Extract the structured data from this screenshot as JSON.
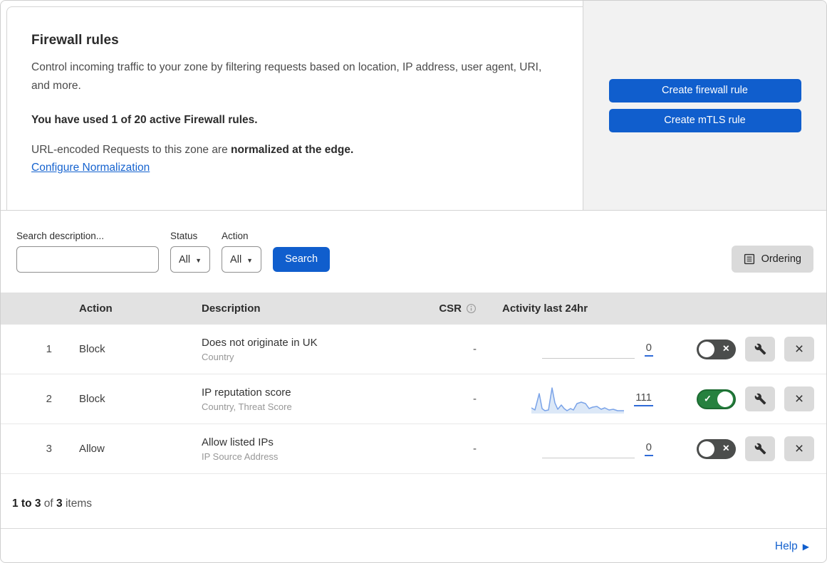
{
  "header": {
    "title": "Firewall rules",
    "description": "Control incoming traffic to your zone by filtering requests based on location, IP address, user agent, URI, and more.",
    "usage": "You have used 1 of 20 active Firewall rules.",
    "normalization_prefix": "URL-encoded Requests to this zone are ",
    "normalization_bold": "normalized at the edge.",
    "normalization_link": "Configure Normalization",
    "create_firewall_label": "Create firewall rule",
    "create_mtls_label": "Create mTLS rule"
  },
  "filters": {
    "search_label": "Search description...",
    "status_label": "Status",
    "status_value": "All",
    "action_label": "Action",
    "action_value": "All",
    "search_button_label": "Search",
    "ordering_label": "Ordering"
  },
  "table": {
    "columns": {
      "action": "Action",
      "description": "Description",
      "csr": "CSR",
      "activity": "Activity last 24hr"
    },
    "rows": [
      {
        "index": "1",
        "action": "Block",
        "description": "Does not originate in UK",
        "criteria": "Country",
        "csr": "-",
        "count": "0",
        "toggle": "off"
      },
      {
        "index": "2",
        "action": "Block",
        "description": "IP reputation score",
        "criteria": "Country, Threat Score",
        "csr": "-",
        "count": "111",
        "toggle": "on",
        "spark": {
          "line": "0,32 5,35 11,12 15,33 19,36 24,35 29,4 33,25 37,34 42,28 46,33 50,36 55,33 59,35 64,26 70,24 76,26 81,33 86,31 92,30 98,34 103,32 109,35 115,34 121,36 130,36",
          "fill": "0,32 5,35 11,12 15,33 19,36 24,35 29,4 33,25 37,34 42,28 46,33 50,36 55,33 59,35 64,26 70,24 76,26 81,33 86,31 92,30 98,34 103,32 109,35 115,34 121,36 130,36 130,40 0,40"
        }
      },
      {
        "index": "3",
        "action": "Allow",
        "description": "Allow listed IPs",
        "criteria": "IP Source Address",
        "csr": "-",
        "count": "0",
        "toggle": "off"
      }
    ]
  },
  "footer": {
    "range": "1 to 3",
    "of": " of ",
    "total": "3",
    "items": " items",
    "help": "Help"
  },
  "colors": {
    "primary_blue": "#105ecd",
    "link_blue": "#1663cf",
    "toggle_on_green": "#26813f",
    "toggle_off_gray": "#4b4d4c",
    "sparkline_line": "#7aa3e8",
    "sparkline_fill": "#dce8f7",
    "table_header_bg": "#e2e2e2",
    "cta_panel_bg": "#f2f2f2"
  }
}
